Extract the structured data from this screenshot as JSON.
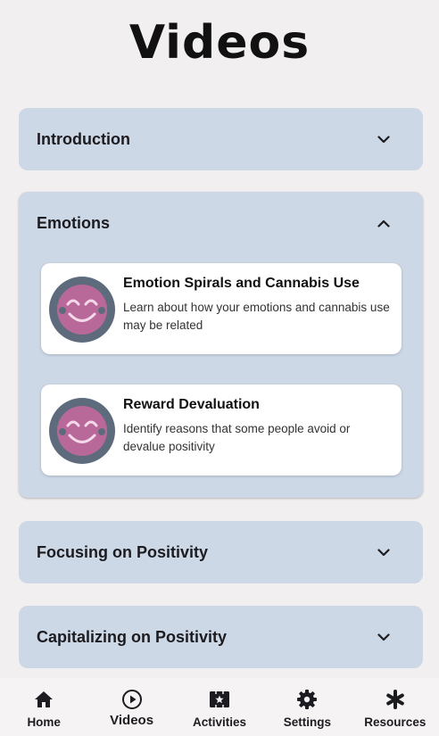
{
  "page": {
    "title": "Videos"
  },
  "sections": [
    {
      "title": "Introduction",
      "expanded": false
    },
    {
      "title": "Emotions",
      "expanded": true,
      "videos": [
        {
          "title": "Emotion Spirals and Cannabis Use",
          "description": "Learn about how your emotions and cannabis use may be related",
          "icon": "smiley-face-icon"
        },
        {
          "title": "Reward Devaluation",
          "description": "Identify reasons that some people avoid or devalue positivity",
          "icon": "smiley-face-icon"
        }
      ]
    },
    {
      "title": "Focusing on Positivity",
      "expanded": false
    },
    {
      "title": "Capitalizing on Positivity",
      "expanded": false
    }
  ],
  "nav": {
    "items": [
      {
        "label": "Home",
        "icon": "home-icon"
      },
      {
        "label": "Videos",
        "icon": "play-circle-icon",
        "active": true
      },
      {
        "label": "Activities",
        "icon": "activities-icon"
      },
      {
        "label": "Settings",
        "icon": "gear-icon"
      },
      {
        "label": "Resources",
        "icon": "asterisk-icon"
      }
    ]
  },
  "colors": {
    "background": "#f2eff1",
    "panel": "#cdd8e6",
    "card": "#ffffff",
    "avatar_ring": "#5d6b7c",
    "avatar_face": "#b8699a"
  }
}
